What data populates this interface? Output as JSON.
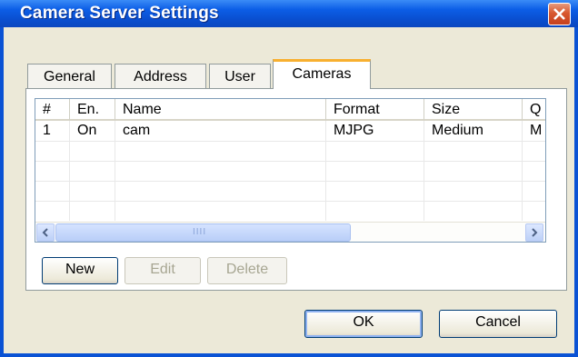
{
  "window": {
    "title": "Camera Server Settings"
  },
  "tabs": [
    {
      "label": "General",
      "active": false
    },
    {
      "label": "Address",
      "active": false
    },
    {
      "label": "User",
      "active": false
    },
    {
      "label": "Cameras",
      "active": true
    }
  ],
  "table": {
    "columns": [
      "#",
      "En.",
      "Name",
      "Format",
      "Size",
      "Q"
    ],
    "rows": [
      [
        "1",
        "On",
        "cam",
        "MJPG",
        "Medium",
        "M"
      ]
    ]
  },
  "list_buttons": {
    "new": "New",
    "edit": "Edit",
    "delete": "Delete"
  },
  "dialog_buttons": {
    "ok": "OK",
    "cancel": "Cancel"
  },
  "scroll_grip": "IIII",
  "colors": {
    "title_bar": "#0a4fd0",
    "dialog_bg": "#ece9d8",
    "active_tab_accent": "#f8b030",
    "close_button": "#d8582f"
  }
}
